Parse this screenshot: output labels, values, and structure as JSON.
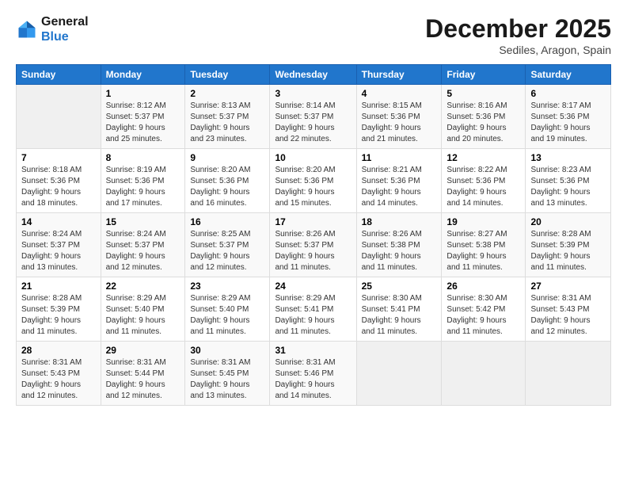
{
  "logo": {
    "line1": "General",
    "line2": "Blue"
  },
  "title": "December 2025",
  "subtitle": "Sediles, Aragon, Spain",
  "headers": [
    "Sunday",
    "Monday",
    "Tuesday",
    "Wednesday",
    "Thursday",
    "Friday",
    "Saturday"
  ],
  "weeks": [
    [
      {
        "day": "",
        "info": ""
      },
      {
        "day": "1",
        "info": "Sunrise: 8:12 AM\nSunset: 5:37 PM\nDaylight: 9 hours\nand 25 minutes."
      },
      {
        "day": "2",
        "info": "Sunrise: 8:13 AM\nSunset: 5:37 PM\nDaylight: 9 hours\nand 23 minutes."
      },
      {
        "day": "3",
        "info": "Sunrise: 8:14 AM\nSunset: 5:37 PM\nDaylight: 9 hours\nand 22 minutes."
      },
      {
        "day": "4",
        "info": "Sunrise: 8:15 AM\nSunset: 5:36 PM\nDaylight: 9 hours\nand 21 minutes."
      },
      {
        "day": "5",
        "info": "Sunrise: 8:16 AM\nSunset: 5:36 PM\nDaylight: 9 hours\nand 20 minutes."
      },
      {
        "day": "6",
        "info": "Sunrise: 8:17 AM\nSunset: 5:36 PM\nDaylight: 9 hours\nand 19 minutes."
      }
    ],
    [
      {
        "day": "7",
        "info": "Sunrise: 8:18 AM\nSunset: 5:36 PM\nDaylight: 9 hours\nand 18 minutes."
      },
      {
        "day": "8",
        "info": "Sunrise: 8:19 AM\nSunset: 5:36 PM\nDaylight: 9 hours\nand 17 minutes."
      },
      {
        "day": "9",
        "info": "Sunrise: 8:20 AM\nSunset: 5:36 PM\nDaylight: 9 hours\nand 16 minutes."
      },
      {
        "day": "10",
        "info": "Sunrise: 8:20 AM\nSunset: 5:36 PM\nDaylight: 9 hours\nand 15 minutes."
      },
      {
        "day": "11",
        "info": "Sunrise: 8:21 AM\nSunset: 5:36 PM\nDaylight: 9 hours\nand 14 minutes."
      },
      {
        "day": "12",
        "info": "Sunrise: 8:22 AM\nSunset: 5:36 PM\nDaylight: 9 hours\nand 14 minutes."
      },
      {
        "day": "13",
        "info": "Sunrise: 8:23 AM\nSunset: 5:36 PM\nDaylight: 9 hours\nand 13 minutes."
      }
    ],
    [
      {
        "day": "14",
        "info": "Sunrise: 8:24 AM\nSunset: 5:37 PM\nDaylight: 9 hours\nand 13 minutes."
      },
      {
        "day": "15",
        "info": "Sunrise: 8:24 AM\nSunset: 5:37 PM\nDaylight: 9 hours\nand 12 minutes."
      },
      {
        "day": "16",
        "info": "Sunrise: 8:25 AM\nSunset: 5:37 PM\nDaylight: 9 hours\nand 12 minutes."
      },
      {
        "day": "17",
        "info": "Sunrise: 8:26 AM\nSunset: 5:37 PM\nDaylight: 9 hours\nand 11 minutes."
      },
      {
        "day": "18",
        "info": "Sunrise: 8:26 AM\nSunset: 5:38 PM\nDaylight: 9 hours\nand 11 minutes."
      },
      {
        "day": "19",
        "info": "Sunrise: 8:27 AM\nSunset: 5:38 PM\nDaylight: 9 hours\nand 11 minutes."
      },
      {
        "day": "20",
        "info": "Sunrise: 8:28 AM\nSunset: 5:39 PM\nDaylight: 9 hours\nand 11 minutes."
      }
    ],
    [
      {
        "day": "21",
        "info": "Sunrise: 8:28 AM\nSunset: 5:39 PM\nDaylight: 9 hours\nand 11 minutes."
      },
      {
        "day": "22",
        "info": "Sunrise: 8:29 AM\nSunset: 5:40 PM\nDaylight: 9 hours\nand 11 minutes."
      },
      {
        "day": "23",
        "info": "Sunrise: 8:29 AM\nSunset: 5:40 PM\nDaylight: 9 hours\nand 11 minutes."
      },
      {
        "day": "24",
        "info": "Sunrise: 8:29 AM\nSunset: 5:41 PM\nDaylight: 9 hours\nand 11 minutes."
      },
      {
        "day": "25",
        "info": "Sunrise: 8:30 AM\nSunset: 5:41 PM\nDaylight: 9 hours\nand 11 minutes."
      },
      {
        "day": "26",
        "info": "Sunrise: 8:30 AM\nSunset: 5:42 PM\nDaylight: 9 hours\nand 11 minutes."
      },
      {
        "day": "27",
        "info": "Sunrise: 8:31 AM\nSunset: 5:43 PM\nDaylight: 9 hours\nand 12 minutes."
      }
    ],
    [
      {
        "day": "28",
        "info": "Sunrise: 8:31 AM\nSunset: 5:43 PM\nDaylight: 9 hours\nand 12 minutes."
      },
      {
        "day": "29",
        "info": "Sunrise: 8:31 AM\nSunset: 5:44 PM\nDaylight: 9 hours\nand 12 minutes."
      },
      {
        "day": "30",
        "info": "Sunrise: 8:31 AM\nSunset: 5:45 PM\nDaylight: 9 hours\nand 13 minutes."
      },
      {
        "day": "31",
        "info": "Sunrise: 8:31 AM\nSunset: 5:46 PM\nDaylight: 9 hours\nand 14 minutes."
      },
      {
        "day": "",
        "info": ""
      },
      {
        "day": "",
        "info": ""
      },
      {
        "day": "",
        "info": ""
      }
    ]
  ]
}
